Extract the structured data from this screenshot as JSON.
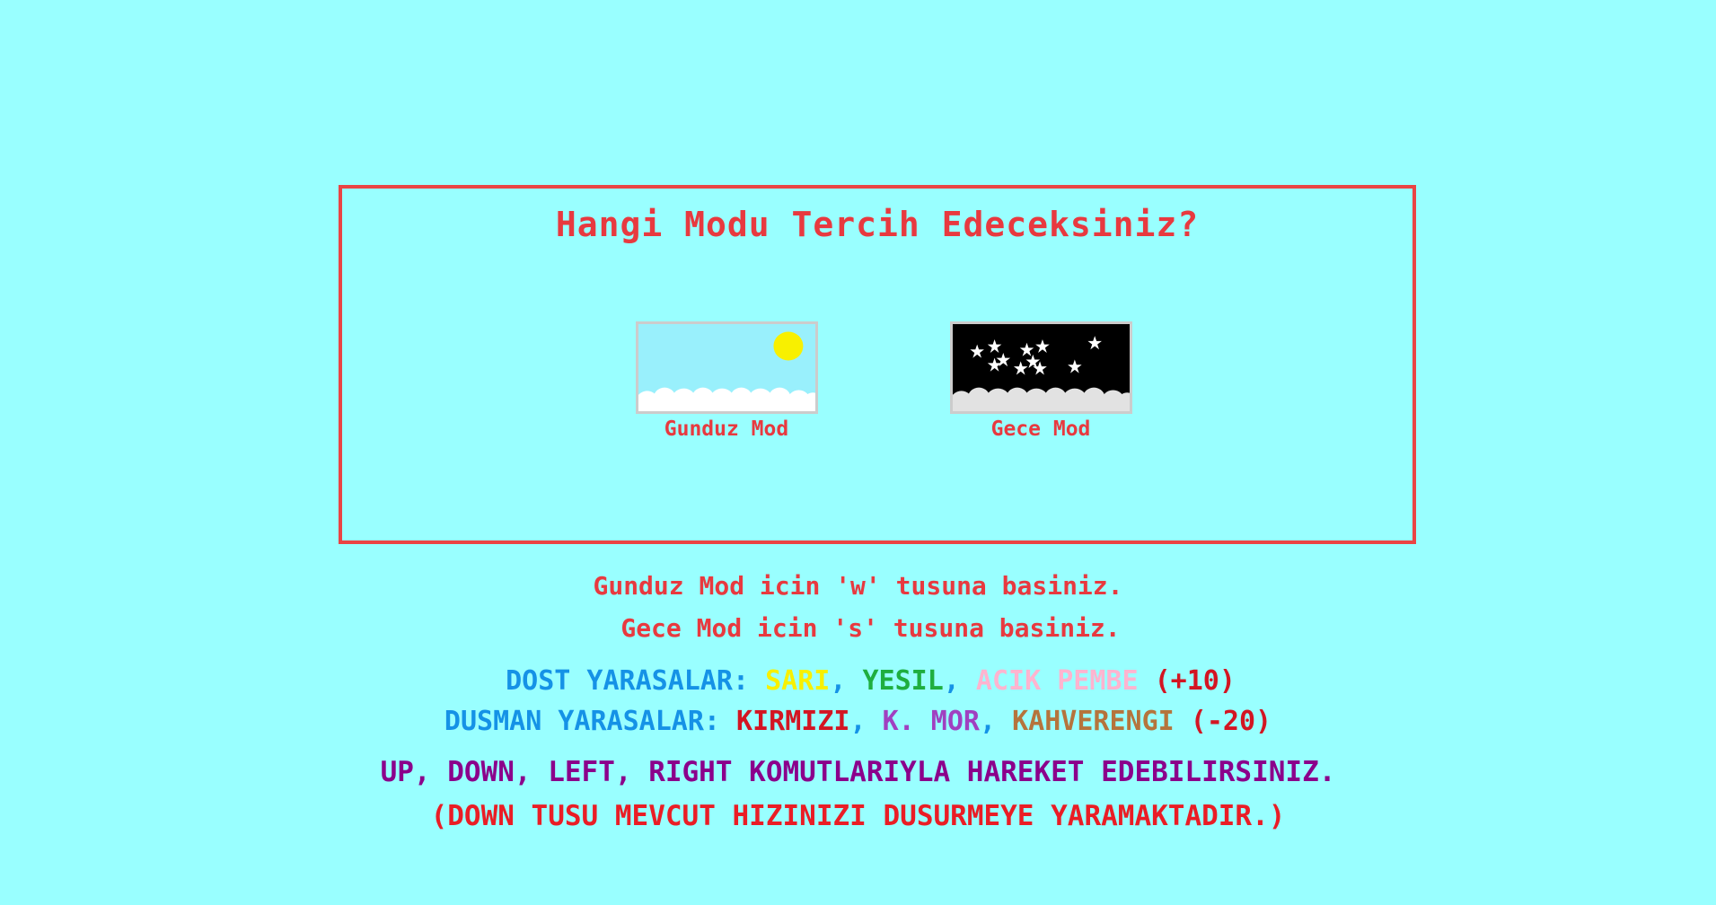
{
  "dialog": {
    "title": "Hangi Modu Tercih Edeceksiniz?",
    "options": [
      {
        "label": "Gunduz Mod"
      },
      {
        "label": "Gece Mod"
      }
    ]
  },
  "instructions": {
    "day_key": "Gunduz Mod icin 'w' tusuna basiniz.",
    "night_key": "Gece Mod icin 's' tusuna basiniz.",
    "friends": {
      "label": "DOST YARASALAR:",
      "colors": [
        "SARI",
        "YESIL",
        "ACIK PEMBE"
      ],
      "points": "(+10)"
    },
    "enemies": {
      "label": "DUSMAN YARASALAR:",
      "colors": [
        "KIRMIZI",
        "K. MOR",
        "KAHVERENGI"
      ],
      "points": "(-20)"
    },
    "movement": "UP, DOWN, LEFT, RIGHT KOMUTLARIYLA HAREKET EDEBILIRSINIZ.",
    "down_note": "(DOWN TUSU MEVCUT HIZINIZI DUSURMEYE YARAMAKTADIR.)",
    "separator": ","
  },
  "icons": {
    "day_thumbnail": "sun-cloud-sky-icon",
    "night_thumbnail": "stars-cloud-night-icon"
  },
  "colors": {
    "background": "#99ffff",
    "accent_red": "#e8393f",
    "blue": "#1592e6",
    "yellow": "#f8f000",
    "green": "#1fae3f",
    "pink": "#ffb4cf",
    "purple": "#a040c0",
    "brown": "#b5743c",
    "movement": "#8b008b"
  }
}
